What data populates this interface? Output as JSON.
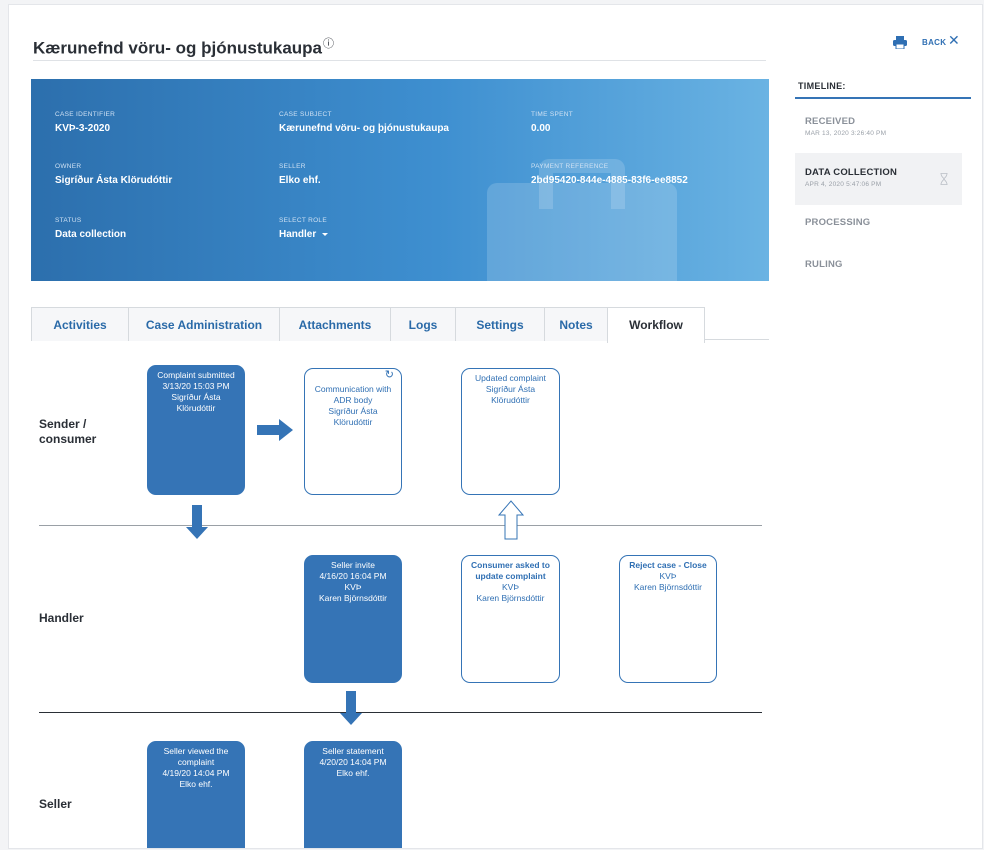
{
  "header": {
    "title": "Kærunefnd vöru- og þjónustukaupa",
    "info_marker": "ⓘ",
    "back_label": "BACK",
    "close_glyph": "✕"
  },
  "case": {
    "fields": [
      {
        "label": "CASE IDENTIFIER",
        "value": "KVÞ-3-2020"
      },
      {
        "label": "CASE SUBJECT",
        "value": "Kærunefnd vöru- og þjónustukaupa"
      },
      {
        "label": "TIME SPENT",
        "value": "0.00"
      },
      {
        "label": "OWNER",
        "value": "Sigríður Ásta Klörudóttir"
      },
      {
        "label": "SELLER",
        "value": "Elko ehf."
      },
      {
        "label": "PAYMENT REFERENCE",
        "value": "2bd95420-844e-4885-83f6-ee8852"
      },
      {
        "label": "STATUS",
        "value": "Data collection"
      },
      {
        "label": "SELECT ROLE",
        "value": "Handler"
      }
    ]
  },
  "tabs": [
    "Activities",
    "Case Administration",
    "Attachments",
    "Logs",
    "Settings",
    "Notes",
    "Workflow"
  ],
  "active_tab": "Workflow",
  "workflow": {
    "lanes": [
      "Sender /\nconsumer",
      "Handler",
      "Seller"
    ],
    "boxes": [
      {
        "lines": [
          "Complaint submitted",
          "3/13/20 15:03 PM",
          "Sigríður Ásta",
          "Klörudóttir"
        ]
      },
      {
        "lines": [
          "Communication with",
          "ADR body",
          "Sigríður Ásta",
          "Klörudóttir"
        ],
        "refresh_icon": "↻"
      },
      {
        "lines": [
          "Updated complaint",
          "Sigríður Ásta",
          "Klörudóttir"
        ]
      },
      {
        "lines": [
          "Seller invite",
          "4/16/20 16:04 PM",
          "KVÞ",
          "Karen Björnsdóttir"
        ]
      },
      {
        "title": "Consumer asked to update complaint",
        "lines": [
          "KVÞ",
          "Karen Björnsdóttir"
        ]
      },
      {
        "title": "Reject case - Close",
        "lines": [
          "KVÞ",
          "Karen Björnsdóttir"
        ]
      },
      {
        "lines": [
          "Seller viewed the",
          "complaint",
          "4/19/20 14:04 PM",
          "Elko ehf."
        ]
      },
      {
        "lines": [
          "Seller statement",
          "4/20/20 14:04 PM",
          "Elko ehf."
        ]
      }
    ]
  },
  "timeline": {
    "heading": "TIMELINE:",
    "items": [
      {
        "name": "RECEIVED",
        "date": "MAR 13, 2020 3:26:40 PM"
      },
      {
        "name": "DATA COLLECTION",
        "date": "APR 4, 2020 5:47:06 PM"
      },
      {
        "name": "PROCESSING",
        "date": ""
      },
      {
        "name": "RULING",
        "date": ""
      }
    ],
    "active_item": "DATA COLLECTION",
    "active_icon": "hourglass-icon"
  },
  "colors": {
    "accent": "#3574b6",
    "banner_start": "#2c6fad",
    "banner_end": "#6ab3e3"
  }
}
